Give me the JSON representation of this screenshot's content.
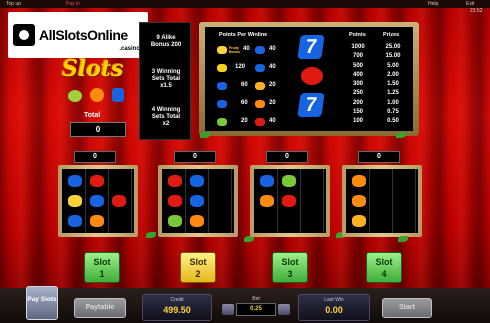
{
  "topbar": {
    "top_up": "Top up",
    "pay_in": "Pay in",
    "help": "Help",
    "exit": "Exit",
    "clock": "23:52"
  },
  "watermark": {
    "brand": "AllSlotsOnline",
    "sub": ".casino"
  },
  "logo": {
    "text": "Slots"
  },
  "total": {
    "label": "Total",
    "value": "0"
  },
  "rules": {
    "line1": "9 Alike",
    "line2": "Bonus 200",
    "line3": "3 Winning",
    "line4": "Sets Total",
    "line5": "x1.5",
    "line6": "4 Winning",
    "line7": "Sets Total",
    "line8": "x2"
  },
  "paytable": {
    "header_left": "Points Per Winline",
    "header_points": "Points",
    "header_prizes": "Prizes",
    "wins_left": [
      {
        "icon": "bonus-icon",
        "label": "Fruity Bonus",
        "value": "40"
      },
      {
        "icon": "banana-icon",
        "value": "120"
      },
      {
        "icon": "blue-seven-icon",
        "value": "60"
      },
      {
        "icon": "blue-seven-icon",
        "value": "60"
      },
      {
        "icon": "grape-icon",
        "value": "20"
      }
    ],
    "wins_right": [
      {
        "icon": "lemon-icon",
        "value": "40"
      },
      {
        "icon": "orange-icon",
        "value": "40"
      },
      {
        "icon": "lemon-icon",
        "value": "20"
      },
      {
        "icon": "orange-icon",
        "value": "20"
      },
      {
        "icon": "strawberry-icon",
        "value": "40"
      }
    ],
    "points": [
      "1000",
      "700",
      "500",
      "400",
      "300",
      "250",
      "200",
      "150",
      "100"
    ],
    "prizes": [
      "25.00",
      "15.00",
      "5.00",
      "2.00",
      "1.50",
      "1.25",
      "1.00",
      "0.75",
      "0.50"
    ]
  },
  "slots": [
    {
      "count": "0",
      "label": "Slot",
      "number": "1"
    },
    {
      "count": "0",
      "label": "Slot",
      "number": "2"
    },
    {
      "count": "0",
      "label": "Slot",
      "number": "3"
    },
    {
      "count": "0",
      "label": "Slot",
      "number": "4"
    }
  ],
  "bottom": {
    "pay_slots": "Pay Slots",
    "paytable": "Paytable",
    "credit_label": "Credit",
    "credit_value": "499.50",
    "bet_label": "Bet",
    "bet_value": "0.25",
    "last_win_label": "Last Win",
    "last_win_value": "0.00",
    "start": "Start"
  },
  "colors": {
    "curtain": "#c40a05",
    "gold": "#ffd23a",
    "frame": "#c9b178",
    "slot_button": "#3fae3a",
    "slot_active": "#e4b818"
  }
}
